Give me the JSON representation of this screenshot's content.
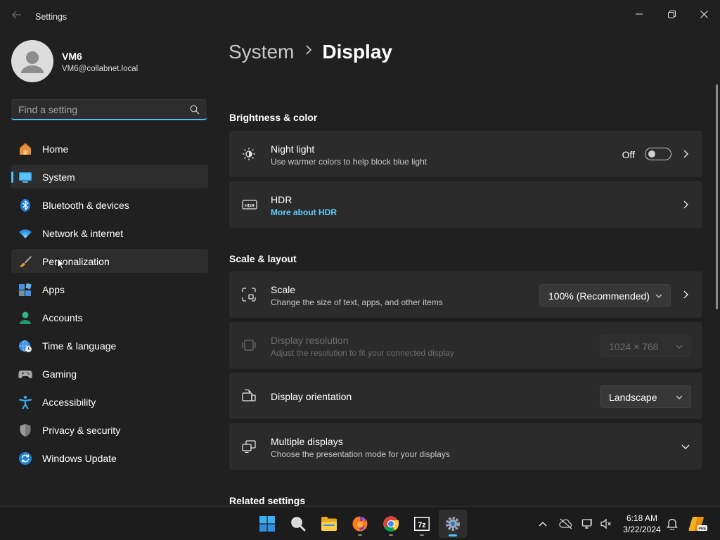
{
  "window": {
    "title": "Settings"
  },
  "profile": {
    "name": "VM6",
    "email": "VM6@collabnet.local"
  },
  "search": {
    "placeholder": "Find a setting"
  },
  "nav": [
    {
      "label": "Home",
      "icon": "home-icon"
    },
    {
      "label": "System",
      "icon": "system-icon",
      "active": true
    },
    {
      "label": "Bluetooth & devices",
      "icon": "bluetooth-icon"
    },
    {
      "label": "Network & internet",
      "icon": "wifi-icon"
    },
    {
      "label": "Personalization",
      "icon": "brush-icon"
    },
    {
      "label": "Apps",
      "icon": "apps-icon"
    },
    {
      "label": "Accounts",
      "icon": "accounts-icon"
    },
    {
      "label": "Time & language",
      "icon": "globe-clock-icon"
    },
    {
      "label": "Gaming",
      "icon": "gamepad-icon"
    },
    {
      "label": "Accessibility",
      "icon": "accessibility-icon"
    },
    {
      "label": "Privacy & security",
      "icon": "shield-icon"
    },
    {
      "label": "Windows Update",
      "icon": "update-icon"
    }
  ],
  "breadcrumb": {
    "parent": "System",
    "current": "Display"
  },
  "sections": {
    "brightness": "Brightness & color",
    "scale_layout": "Scale & layout",
    "related": "Related settings"
  },
  "night_light": {
    "title": "Night light",
    "subtitle": "Use warmer colors to help block blue light",
    "state": "Off"
  },
  "hdr": {
    "title": "HDR",
    "link": "More about HDR"
  },
  "scale": {
    "title": "Scale",
    "subtitle": "Change the size of text, apps, and other items",
    "value": "100% (Recommended)"
  },
  "resolution": {
    "title": "Display resolution",
    "subtitle": "Adjust the resolution to fit your connected display",
    "value": "1024 × 768"
  },
  "orientation": {
    "title": "Display orientation",
    "value": "Landscape"
  },
  "multiple": {
    "title": "Multiple displays",
    "subtitle": "Choose the presentation mode for your displays"
  },
  "taskbar": {
    "apps": [
      "start",
      "search",
      "file-explorer",
      "firefox",
      "chrome",
      "7-zip",
      "settings"
    ],
    "time": "6:18 AM",
    "date": "3/22/2024"
  },
  "colors": {
    "accent": "#4cc2ff",
    "link": "#60cdff",
    "background": "#202020",
    "card": "#2b2b2b"
  }
}
